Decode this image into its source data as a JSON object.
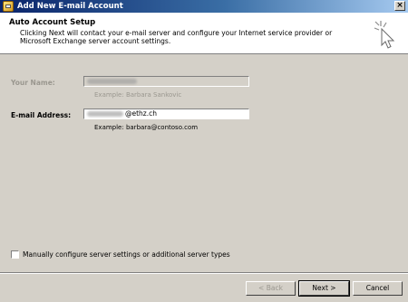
{
  "window": {
    "title": "Add New E-mail Account",
    "close_glyph": "×"
  },
  "header": {
    "heading": "Auto Account Setup",
    "description": "Clicking Next will contact your e-mail server and configure your Internet service provider or Microsoft Exchange server account settings."
  },
  "form": {
    "name_label": "Your Name:",
    "name_hint": "Example: Barbara Sankovic",
    "email_label": "E-mail Address:",
    "email_value_visible": "@ethz.ch",
    "email_hint": "Example: barbara@contoso.com"
  },
  "options": {
    "manual_label": "Manually configure server settings or additional server types",
    "manual_checked": false
  },
  "buttons": {
    "back": "< Back",
    "next": "Next >",
    "cancel": "Cancel"
  },
  "icons": {
    "app": "outlook-envelope-icon",
    "wizard": "cursor-sparkle-icon",
    "close": "close-icon"
  }
}
